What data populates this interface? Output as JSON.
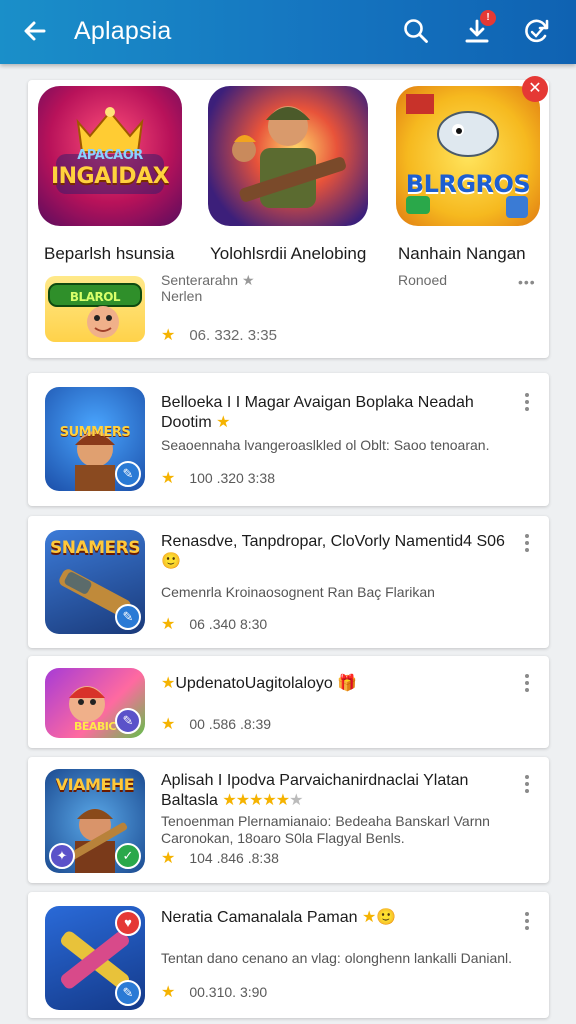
{
  "app_bar": {
    "title": "Aplapsia",
    "notification_count": "!"
  },
  "featured": [
    {
      "name": "Beparlsh hsunsia",
      "icon_text": "INGAIDAX",
      "icon_small_text": "APACAOR"
    },
    {
      "name": "Yolohlsrdii Anelobing"
    },
    {
      "name": "Nanhain Nangan",
      "icon_text": "BLRGROS"
    }
  ],
  "featured_extra": {
    "sub1": "Senterarahn",
    "sub2": "Nerlen",
    "rating": "06. 332. 3:35",
    "sub3": "Ronoed",
    "banner_text": "BLAROL"
  },
  "list": [
    {
      "name": "Belloeka I I Magar Avaigan Boplaka Neadah Dootim",
      "desc": "Seaoennaha lvangeroaslkled ol Oblt: Saoo tenoaran.",
      "rating": "100 .320 3:38",
      "icon_text": "SUMMERS"
    },
    {
      "name": "Renasdve, Tanpdropar, CloVorly Namentid4 S06",
      "desc": "Cemenrla Kroinaosognent Ran Baç Flarikan",
      "rating": "06 .340 8:30",
      "icon_text": "SNAMERS"
    },
    {
      "name": "UpdenatoUagitolaloyo",
      "desc": "",
      "rating": "00 .586 .8:39",
      "icon_text": "BEABIC"
    },
    {
      "name": "Aplisah I Ipodva Parvaichanirdnaclai Ylatan Baltasla",
      "desc": "Tenoenman Plernamianaio: Bedeaha Banskarl Varnn Caronokan, 18oaro S0la Flagyal Benls.",
      "rating": "104 .846 .8:38",
      "icon_text": "VIAMEHE"
    },
    {
      "name": "Neratia Camanalala Paman",
      "desc": "Tentan dano cenano an vlag: olonghenn lankalli Danianl.",
      "rating": "00.310. 3:90",
      "icon_text": ""
    }
  ],
  "colors": {
    "appbar": "#1575c0",
    "star": "#f5b301",
    "close": "#e53935"
  }
}
